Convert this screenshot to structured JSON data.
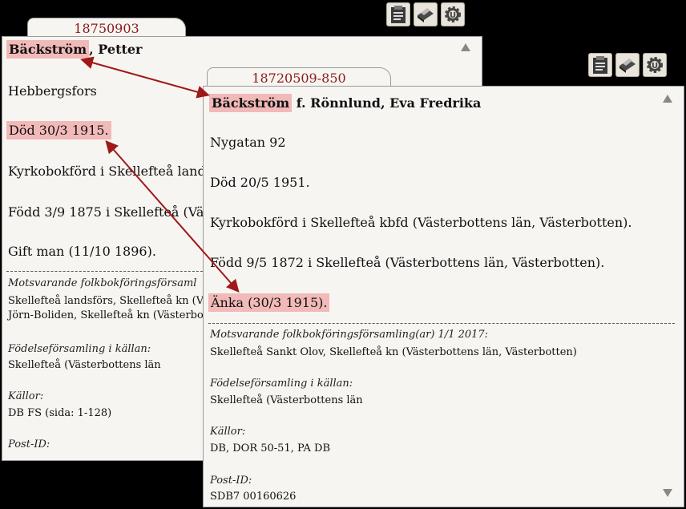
{
  "card1": {
    "tab_title": "18750903",
    "name_surname": "Bäckström",
    "name_rest": ", Petter",
    "address": "Hebbergsfors",
    "death": "Död 30/3 1915.",
    "registered": "Kyrkobokförd i Skellefteå lands",
    "born": "Född 3/9 1875 i Skellefteå (Väs",
    "marital": "Gift man (11/10 1896).",
    "corresponding_label": "Motsvarande folkbokföringsförsaml",
    "corresponding_1": "Skellefteå landsförs, Skellefteå kn (V",
    "corresponding_2": "Jörn-Boliden, Skellefteå kn (Västerbo",
    "birthparish_label": "Födelseförsamling i källan:",
    "birthparish_value": "Skellefteå (Västerbottens län",
    "sources_label": "Källor:",
    "sources_value": "DB FS (sida: 1-128)",
    "postid_label": "Post-ID:"
  },
  "card2": {
    "tab_title": "18720509-850",
    "name_surname": "Bäckström",
    "name_rest": " f. Rönnlund, Eva Fredrika",
    "address": "Nygatan 92",
    "death": "Död 20/5 1951.",
    "registered": "Kyrkobokförd i Skellefteå kbfd (Västerbottens län, Västerbotten).",
    "born": "Född 9/5 1872 i Skellefteå (Västerbottens län, Västerbotten).",
    "marital": "Änka (30/3 1915).",
    "corresponding_label": "Motsvarande folkbokföringsförsamling(ar) 1/1 2017:",
    "corresponding_1": "Skellefteå Sankt Olov, Skellefteå kn (Västerbottens län, Västerbotten)",
    "birthparish_label": "Födelseförsamling i källan:",
    "birthparish_value": "Skellefteå (Västerbottens län",
    "sources_label": "Källor:",
    "sources_value": "DB, DOR 50-51, PA DB",
    "postid_label": "Post-ID:",
    "postid_value": "SDB7  00160626"
  },
  "colors": {
    "highlight": "#f2b9b9",
    "arrow": "#a01818",
    "tab_text": "#8a1a1a"
  },
  "icons": [
    "clipboard-icon",
    "print-icon",
    "settings-gear-icon"
  ]
}
